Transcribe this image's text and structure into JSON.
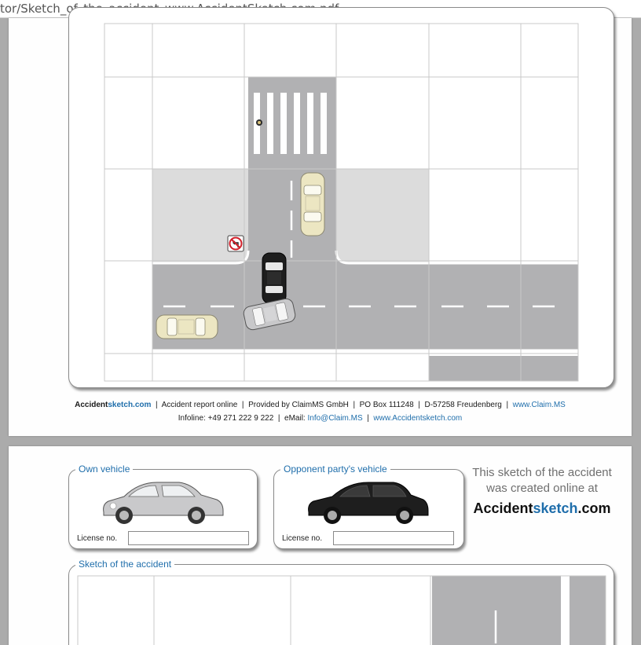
{
  "browser": {
    "url_fragment": "tor/Sketch_of_the_accident_www.AccidentSketch.com.pdf"
  },
  "footer": {
    "brand_a": "Accident",
    "brand_b": "sketch.com",
    "sep": "|",
    "text1": "Accident report online",
    "text2": "Provided by ClaimMS GmbH",
    "text3": "PO Box 111248",
    "text4": "D-57258 Freudenberg",
    "link1": "www.Claim.MS",
    "infoline": "Infoline: +49 271 222 9 222",
    "email_label": "eMail:",
    "email": "Info@Claim.MS",
    "link2": "www.Accidentsketch.com"
  },
  "own_vehicle": {
    "title": "Own vehicle",
    "license_label": "License no.",
    "license_value": ""
  },
  "opponent_vehicle": {
    "title": "Opponent party's vehicle",
    "license_label": "License no.",
    "license_value": ""
  },
  "promo": {
    "line1": "This sketch of the accident",
    "line2": "was created online at",
    "brand_a": "Accident",
    "brand_b": "sketch",
    "brand_c": ".com"
  },
  "sketch2": {
    "title": "Sketch of the accident"
  },
  "colors": {
    "road": "#b1b1b3",
    "sidewalk": "#dcdcdc",
    "accent_blue": "#1f6eab",
    "car_beige": "#ece6c2",
    "car_silver": "#c8c8ca",
    "car_black": "#1e1e1e"
  },
  "icons": {
    "no_left_turn": "no-left-turn-sign-icon",
    "pedestrian": "pedestrian-icon"
  }
}
